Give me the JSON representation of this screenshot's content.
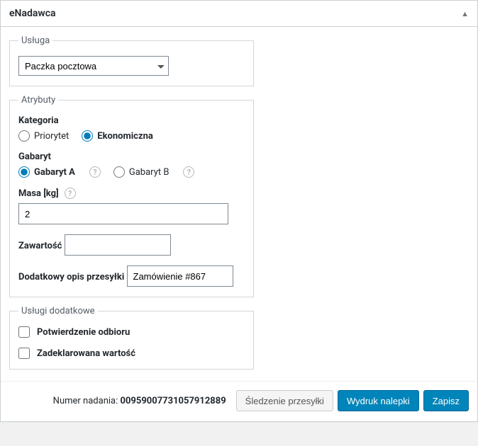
{
  "header": {
    "title": "eNadawca",
    "toggle": "▲"
  },
  "service": {
    "legend": "Usługa",
    "selected": "Paczka pocztowa"
  },
  "attributes": {
    "legend": "Atrybuty",
    "category": {
      "label": "Kategoria",
      "options": [
        {
          "label": "Priorytet",
          "selected": false
        },
        {
          "label": "Ekonomiczna",
          "selected": true
        }
      ]
    },
    "size": {
      "label": "Gabaryt",
      "options": [
        {
          "label": "Gabaryt A",
          "selected": true,
          "help": "?"
        },
        {
          "label": "Gabaryt B",
          "selected": false,
          "help": "?"
        }
      ]
    },
    "weight": {
      "label": "Masa [kg]",
      "help": "?",
      "value": "2"
    },
    "contents": {
      "label": "Zawartość",
      "value": ""
    },
    "extra_desc": {
      "label": "Dodatkowy opis przesyłki",
      "value": "Zamówienie #867"
    }
  },
  "addons": {
    "legend": "Usługi dodatkowe",
    "items": [
      {
        "label": "Potwierdzenie odbioru",
        "checked": false
      },
      {
        "label": "Zadeklarowana wartość",
        "checked": false
      }
    ]
  },
  "footer": {
    "tracking_label": "Numer nadania: ",
    "tracking_number": "00959007731057912889",
    "btn_track": "Śledzenie przesyłki",
    "btn_print": "Wydruk nalepki",
    "btn_save": "Zapisz"
  }
}
